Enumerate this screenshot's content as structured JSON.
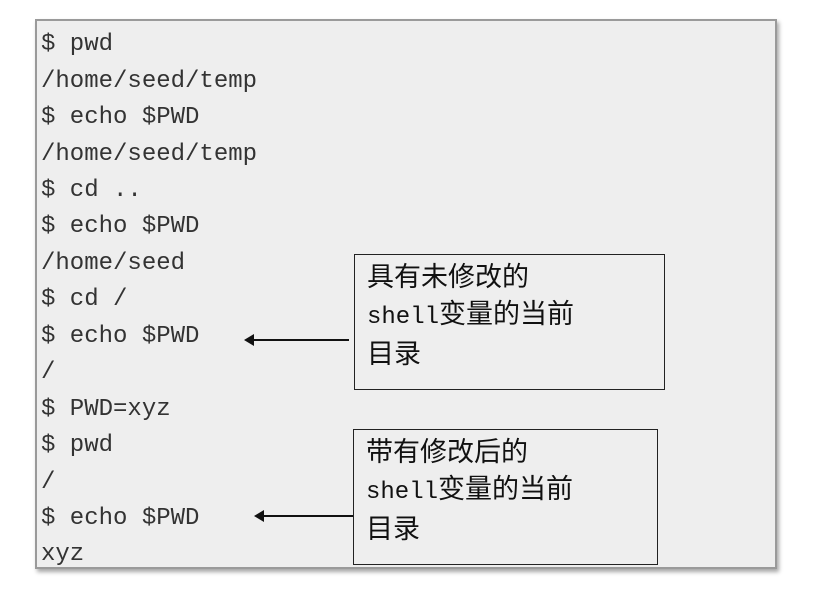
{
  "terminal": {
    "lines": [
      "$ pwd",
      "/home/seed/temp",
      "$ echo $PWD",
      "/home/seed/temp",
      "$ cd ..",
      "$ echo $PWD",
      "/home/seed",
      "$ cd /",
      "$ echo $PWD",
      "/",
      "$ PWD=xyz",
      "$ pwd",
      "/",
      "$ echo $PWD",
      "xyz"
    ]
  },
  "callouts": [
    {
      "line1": "具有未修改的",
      "line2_code": "shell",
      "line2_text": "变量的当前",
      "line3": "目录"
    },
    {
      "line1": "带有修改后的",
      "line2_code": "shell",
      "line2_text": "变量的当前",
      "line3": "目录"
    }
  ]
}
